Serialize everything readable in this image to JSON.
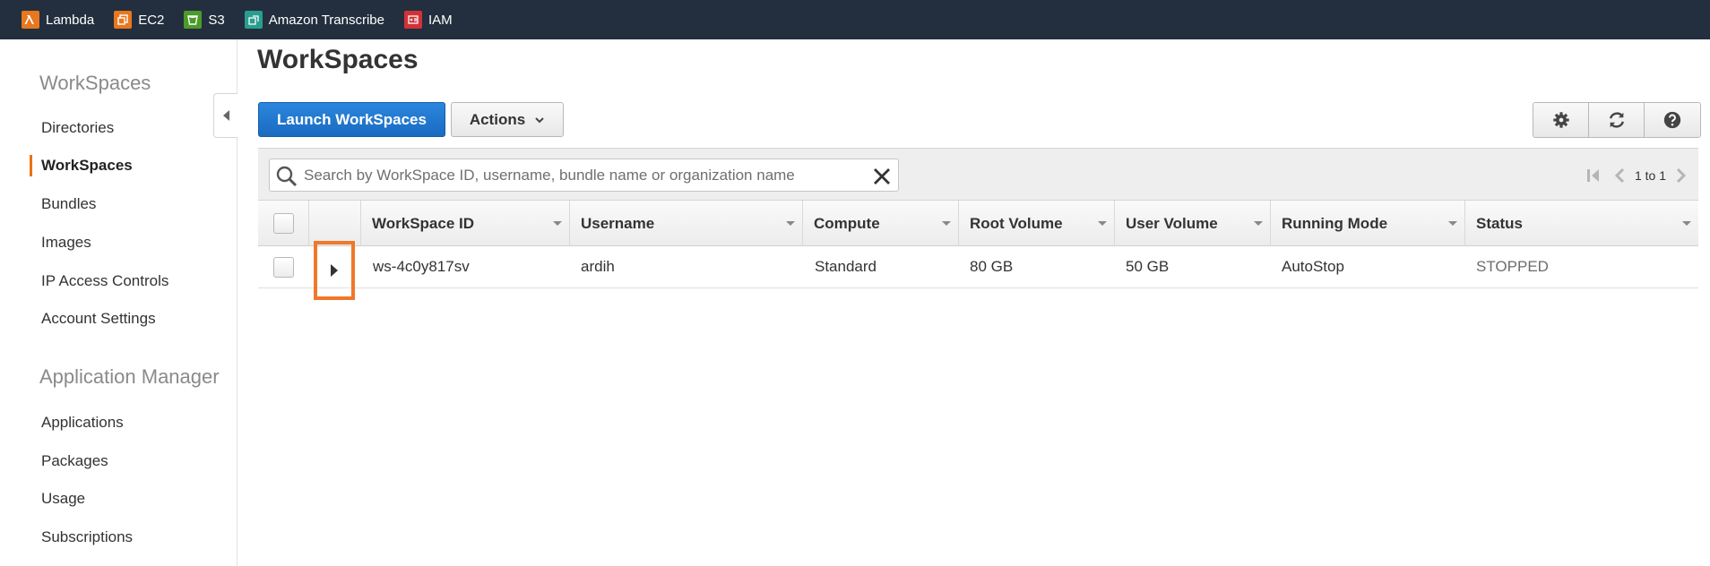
{
  "favorites": [
    {
      "label": "Lambda",
      "color": "#e7781f",
      "icon": "lambda-icon"
    },
    {
      "label": "EC2",
      "color": "#e7781f",
      "icon": "ec2-icon"
    },
    {
      "label": "S3",
      "color": "#4c9a2a",
      "icon": "s3-bucket-icon"
    },
    {
      "label": "Amazon Transcribe",
      "color": "#2a9d8f",
      "icon": "transcribe-icon"
    },
    {
      "label": "IAM",
      "color": "#d13238",
      "icon": "iam-icon"
    }
  ],
  "sidebar": {
    "section1_title": "WorkSpaces",
    "section1_items": [
      {
        "label": "Directories",
        "active": false
      },
      {
        "label": "WorkSpaces",
        "active": true
      },
      {
        "label": "Bundles",
        "active": false
      },
      {
        "label": "Images",
        "active": false
      },
      {
        "label": "IP Access Controls",
        "active": false
      },
      {
        "label": "Account Settings",
        "active": false
      }
    ],
    "section2_title": "Application Manager",
    "section2_items": [
      {
        "label": "Applications"
      },
      {
        "label": "Packages"
      },
      {
        "label": "Usage"
      },
      {
        "label": "Subscriptions"
      }
    ]
  },
  "main": {
    "title": "WorkSpaces",
    "launch_label": "Launch WorkSpaces",
    "actions_label": "Actions",
    "tools": [
      "gear-icon",
      "refresh-icon",
      "help-icon"
    ]
  },
  "search": {
    "placeholder": "Search by WorkSpace ID, username, bundle name or organization name",
    "value": ""
  },
  "pager": {
    "text": "1 to 1"
  },
  "table": {
    "columns": [
      "WorkSpace ID",
      "Username",
      "Compute",
      "Root Volume",
      "User Volume",
      "Running Mode",
      "Status"
    ],
    "rows": [
      {
        "workspace_id": "ws-4c0y817sv",
        "username": "ardih",
        "compute": "Standard",
        "root_volume": "80 GB",
        "user_volume": "50 GB",
        "running_mode": "AutoStop",
        "status": "STOPPED"
      }
    ]
  },
  "colors": {
    "accent": "#ec7211",
    "primary": "#1f74c9",
    "highlight": "#f0782a"
  }
}
